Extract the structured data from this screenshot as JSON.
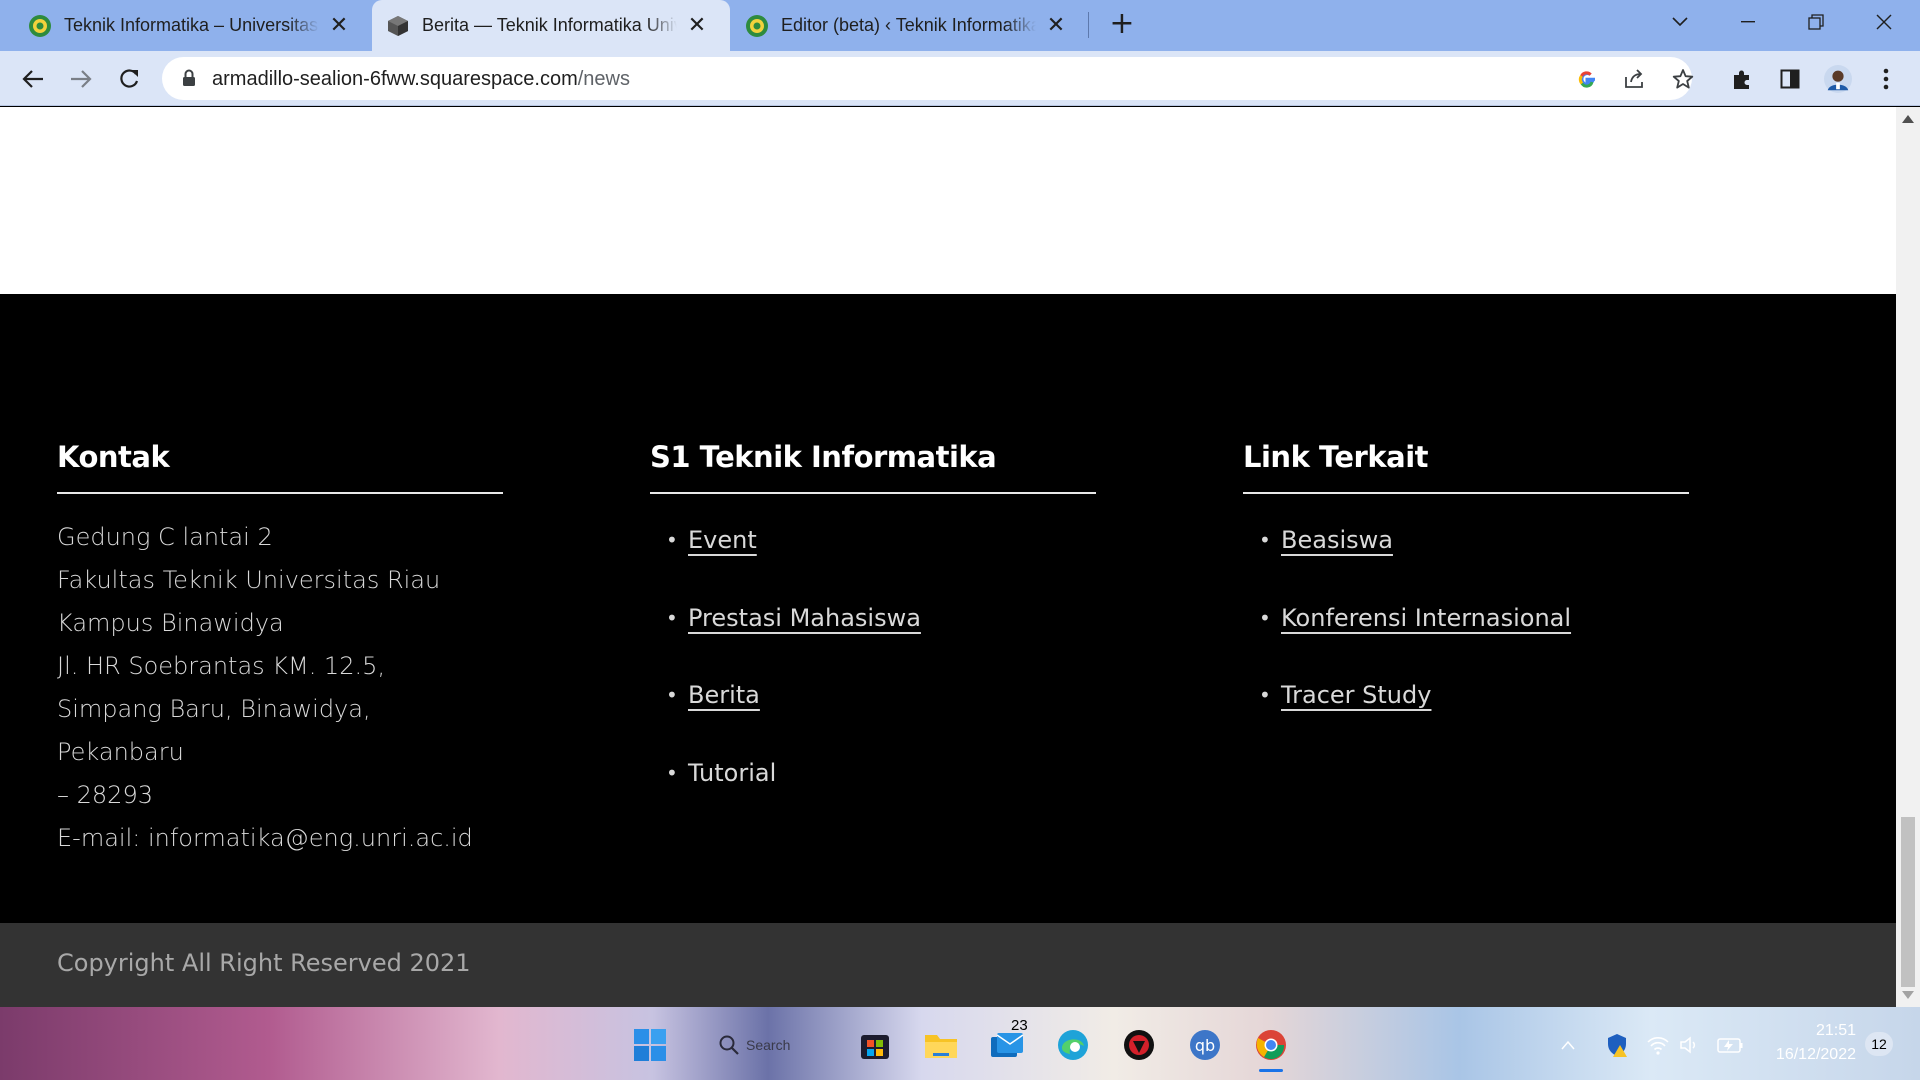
{
  "browser": {
    "tabs": [
      {
        "title": "Teknik Informatika – Universitas Riau",
        "active": false
      },
      {
        "title": "Berita — Teknik Informatika Universitas Riau",
        "active": true
      },
      {
        "title": "Editor (beta) ‹ Teknik Informatika",
        "active": false
      }
    ],
    "url_host": "armadillo-sealion-6fww.squarespace.com",
    "url_path": "/news"
  },
  "footer": {
    "kontak": {
      "heading": "Kontak",
      "lines": [
        "Gedung C lantai 2",
        "Fakultas Teknik Universitas Riau",
        "Kampus Binawidya",
        "Jl. HR Soebrantas KM. 12.5,",
        "Simpang Baru, Binawidya, Pekanbaru",
        "– 28293",
        "E-mail: informatika@eng.unri.ac.id"
      ]
    },
    "program": {
      "heading": "S1 Teknik Informatika",
      "links": [
        "Event",
        "Prestasi Mahasiswa",
        "Berita",
        "Tutorial"
      ]
    },
    "related": {
      "heading": "Link Terkait",
      "links": [
        "Beasiswa",
        "Konferensi Internasional",
        "Tracer Study"
      ]
    },
    "copyright": "Copyright All Right Reserved 2021"
  },
  "taskbar": {
    "search_label": "Search",
    "mail_badge": "23",
    "time": "21:51",
    "date": "16/12/2022",
    "notifications": "12"
  },
  "colors": {
    "tabstrip": "#8fb1ec",
    "toolbar": "#dbe5f7",
    "footer_bg": "#000000",
    "copyright_bg": "#333333"
  }
}
